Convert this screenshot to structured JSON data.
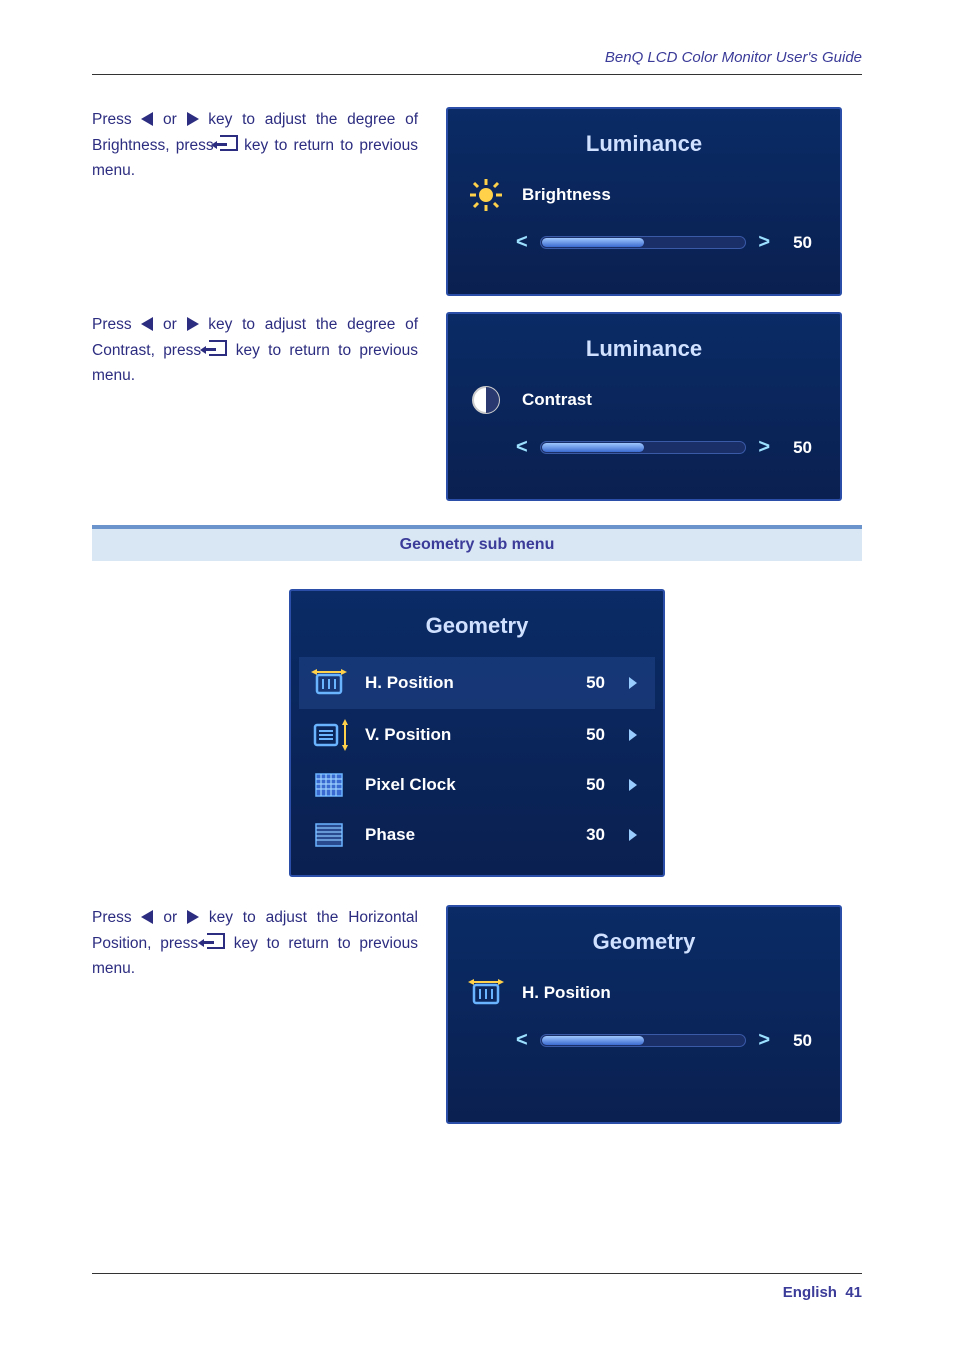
{
  "header": {
    "title_italic": "BenQ LCD Color Monitor User's Guide"
  },
  "sec1": {
    "instr_a": "Press ",
    "instr_b": " or ",
    "instr_c": " key to adjust the degree of Brightness, press ",
    "instr_d": " key to return to previous menu."
  },
  "osd1": {
    "title": "Luminance",
    "item_label": "Brightness",
    "value": "50",
    "fill_pct": 50
  },
  "sec2": {
    "instr_a": "Press ",
    "instr_b": " or ",
    "instr_c": " key to adjust the degree of Contrast, press ",
    "instr_d": " key to return to previous menu."
  },
  "osd2": {
    "title": "Luminance",
    "item_label": "Contrast",
    "value": "50",
    "fill_pct": 50
  },
  "section_heading": "Geometry sub menu",
  "osd3": {
    "title": "Geometry",
    "items": [
      {
        "label": "H. Position",
        "value": "50"
      },
      {
        "label": "V. Position",
        "value": "50"
      },
      {
        "label": "Pixel Clock",
        "value": "50"
      },
      {
        "label": "Phase",
        "value": "30"
      }
    ]
  },
  "sec3": {
    "instr_a": "Press ",
    "instr_b": " or ",
    "instr_c": " key to adjust the Horizontal Position, press ",
    "instr_d": " key to return to previous menu."
  },
  "osd4": {
    "title": "Geometry",
    "item_label": "H. Position",
    "value": "50",
    "fill_pct": 50
  },
  "footer": {
    "lang": "English",
    "page": "41"
  }
}
